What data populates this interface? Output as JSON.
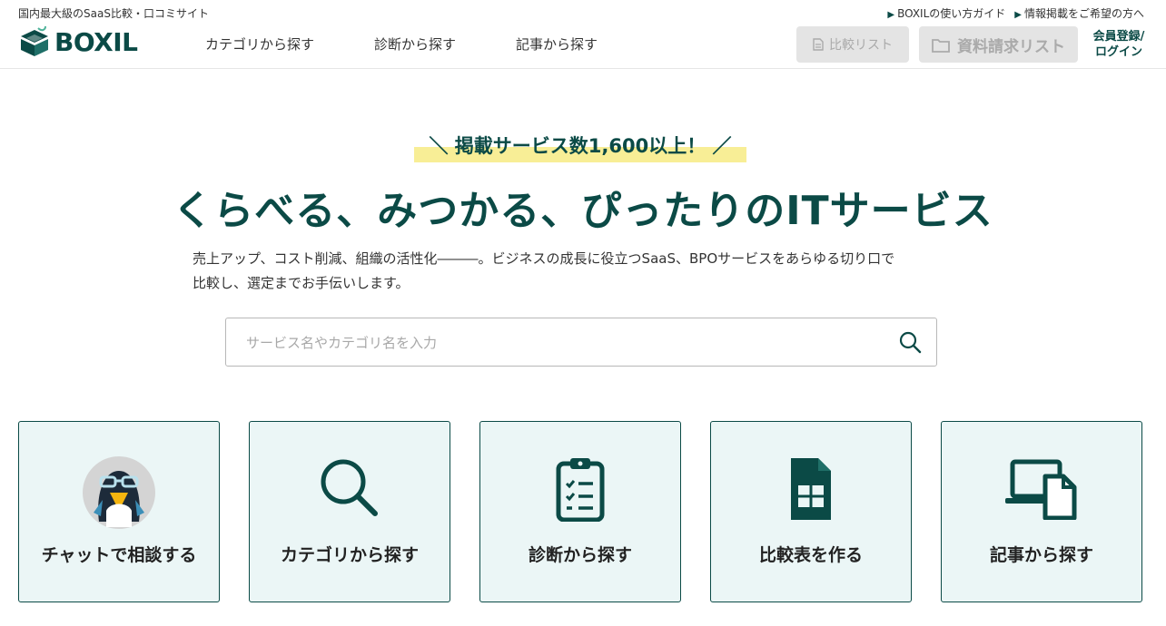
{
  "header": {
    "tagline": "国内最大級のSaaS比較・口コミサイト",
    "logo_text": "BOXIL",
    "nav": [
      "カテゴリから探す",
      "診断から探す",
      "記事から探す"
    ],
    "top_links": [
      "BOXILの使い方ガイド",
      "情報掲載をご希望の方へ"
    ],
    "compare_list": "比較リスト",
    "request_list": "資料請求リスト",
    "login_line1": "会員登録/",
    "login_line2": "ログイン"
  },
  "hero": {
    "badge": "＼ 掲載サービス数1,600以上！ ／",
    "headline": "くらべる、みつかる、ぴったりのITサービス",
    "desc_line1": "売上アップ、コスト削減、組織の活性化―――。ビジネスの成長に役立つSaaS、BPOサービスをあらゆる切り口で",
    "desc_line2": "比較し、選定までお手伝いします。"
  },
  "search": {
    "placeholder": "サービス名やカテゴリ名を入力",
    "value": ""
  },
  "cards": [
    {
      "label": "チャットで相談する",
      "icon": "penguin-mascot-icon"
    },
    {
      "label": "カテゴリから探す",
      "icon": "magnifier-icon"
    },
    {
      "label": "診断から探す",
      "icon": "clipboard-checklist-icon"
    },
    {
      "label": "比較表を作る",
      "icon": "spreadsheet-doc-icon"
    },
    {
      "label": "記事から探す",
      "icon": "laptop-document-icon"
    }
  ],
  "colors": {
    "brand": "#0b4a46",
    "card_bg": "#ebf6f6",
    "highlight": "#f8ee96",
    "disabled_btn": "#e4e4e4"
  }
}
